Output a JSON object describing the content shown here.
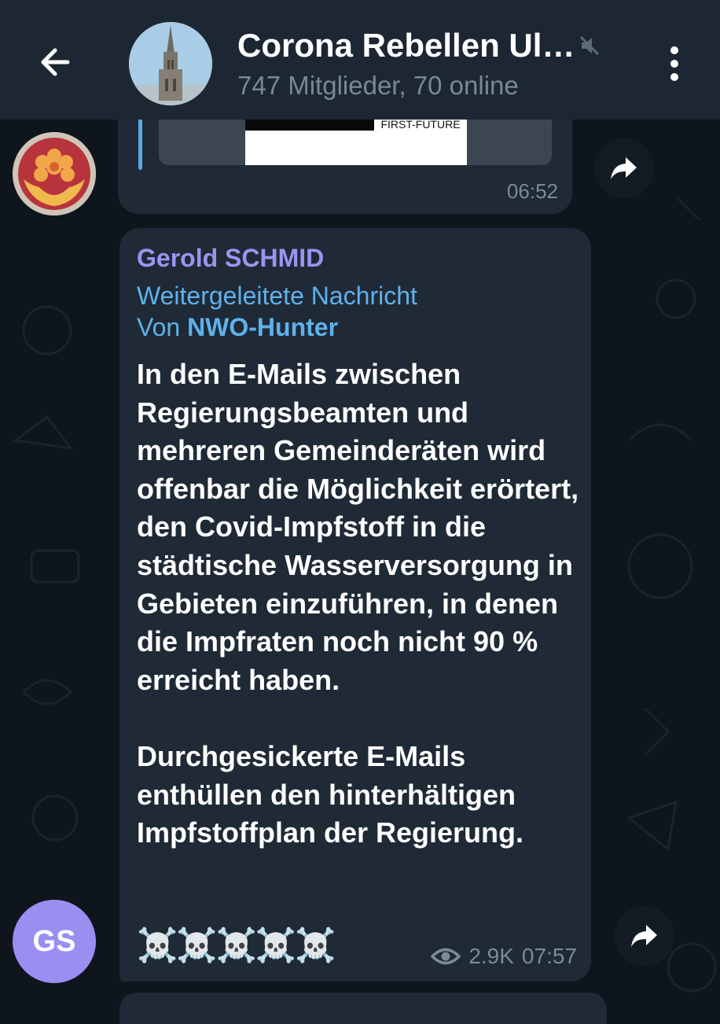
{
  "header": {
    "back_icon": "arrow-left-icon",
    "title": "Corona Rebellen Ul…",
    "subtitle": "747 Mitglieder, 70 online",
    "mute_icon": "speaker-muted-icon",
    "menu_icon": "kebab-menu-icon"
  },
  "top_message": {
    "media_label": "FIRST-FUTURE",
    "time": "06:52"
  },
  "main_message": {
    "sender": "Gerold SCHMID",
    "forward_label": "Weitergeleitete Nachricht",
    "forward_prefix": "Von",
    "forward_from": "NWO-Hunter",
    "body": "In den E-Mails zwischen Regierungsbeamten und mehreren Gemeinderäten wird offenbar die Möglichkeit erörtert, den Covid-Impfstoff in die städtische Wasserversorgung in Gebieten einzuführen, in denen die Impfraten noch nicht 90 % erreicht haben.\n\nDurchgesickerte E-Mails enthüllen den hinterhältigen Impfstoffplan der Regierung.",
    "emojis": "☠️☠️☠️☠️☠️",
    "views": "2.9K",
    "time": "07:57"
  },
  "avatars": {
    "gs_initials": "GS"
  },
  "colors": {
    "background": "#0f151d",
    "header": "#1d2733",
    "bubble": "#1f2a36",
    "sender": "#9d93f0",
    "forward": "#5fb1ec",
    "meta": "#7d8a98"
  }
}
